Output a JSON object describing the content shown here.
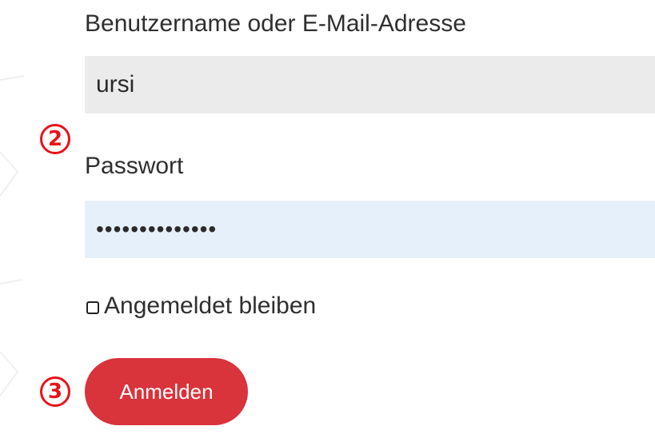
{
  "login_form": {
    "username_label": "Benutzername oder E-Mail-Adresse",
    "username_value": "ursi",
    "password_label": "Passwort",
    "password_value": "••••••••••••••",
    "remember_label": "Angemeldet bleiben",
    "submit_label": "Anmelden"
  },
  "annotations": {
    "step_2": "2",
    "step_3": "3"
  },
  "colors": {
    "submit_background": "#d9333b",
    "annotation_red": "#e8121a",
    "username_field_bg": "#ebebeb",
    "password_field_bg": "#e6f0fa"
  }
}
